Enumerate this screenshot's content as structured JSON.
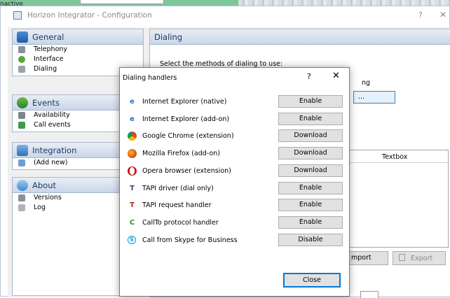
{
  "desktop": {
    "inactive_label": "nactive"
  },
  "window": {
    "title": "Horizon Integrator - Configuration",
    "help": "?",
    "close": "✕"
  },
  "sidebar": {
    "sections": [
      {
        "title": "General",
        "icon": "general-icon",
        "items": [
          {
            "label": "Telephony",
            "icon": "telephony-icon"
          },
          {
            "label": "Interface",
            "icon": "interface-icon"
          },
          {
            "label": "Dialing",
            "icon": "dialing-icon"
          }
        ]
      },
      {
        "title": "Events",
        "icon": "events-icon",
        "items": [
          {
            "label": "Availability",
            "icon": "availability-icon"
          },
          {
            "label": "Call events",
            "icon": "call-events-icon"
          }
        ]
      },
      {
        "title": "Integration",
        "icon": "integration-icon",
        "items": [
          {
            "label": "(Add new)",
            "icon": "add-new-icon"
          }
        ]
      },
      {
        "title": "About",
        "icon": "about-icon",
        "items": [
          {
            "label": "Versions",
            "icon": "versions-icon"
          },
          {
            "label": "Log",
            "icon": "log-icon"
          }
        ]
      }
    ]
  },
  "main": {
    "title": "Dialing",
    "instruction": "Select the methods of dialing to use:",
    "partial_text": "ng",
    "partial_button": "...",
    "table_header": "Textbox",
    "import_label": "mport",
    "export_label": "Export"
  },
  "dialog": {
    "title": "Dialing handlers",
    "help": "?",
    "close": "✕",
    "handlers": [
      {
        "label": "Internet Explorer (native)",
        "action": "Enable",
        "icon": "internet-explorer-icon"
      },
      {
        "label": "Internet Explorer (add-on)",
        "action": "Enable",
        "icon": "internet-explorer-icon"
      },
      {
        "label": "Google Chrome (extension)",
        "action": "Download",
        "icon": "chrome-icon"
      },
      {
        "label": "Mozilla Firefox (add-on)",
        "action": "Download",
        "icon": "firefox-icon"
      },
      {
        "label": "Opera browser (extension)",
        "action": "Download",
        "icon": "opera-icon"
      },
      {
        "label": "TAPI driver (dial only)",
        "action": "Enable",
        "icon": "tapi-icon"
      },
      {
        "label": "TAPI request handler",
        "action": "Enable",
        "icon": "tapi-icon"
      },
      {
        "label": "CallTo protocol handler",
        "action": "Enable",
        "icon": "callto-icon"
      },
      {
        "label": "Call from Skype for Business",
        "action": "Disable",
        "icon": "skype-icon"
      }
    ],
    "close_button": "Close"
  }
}
